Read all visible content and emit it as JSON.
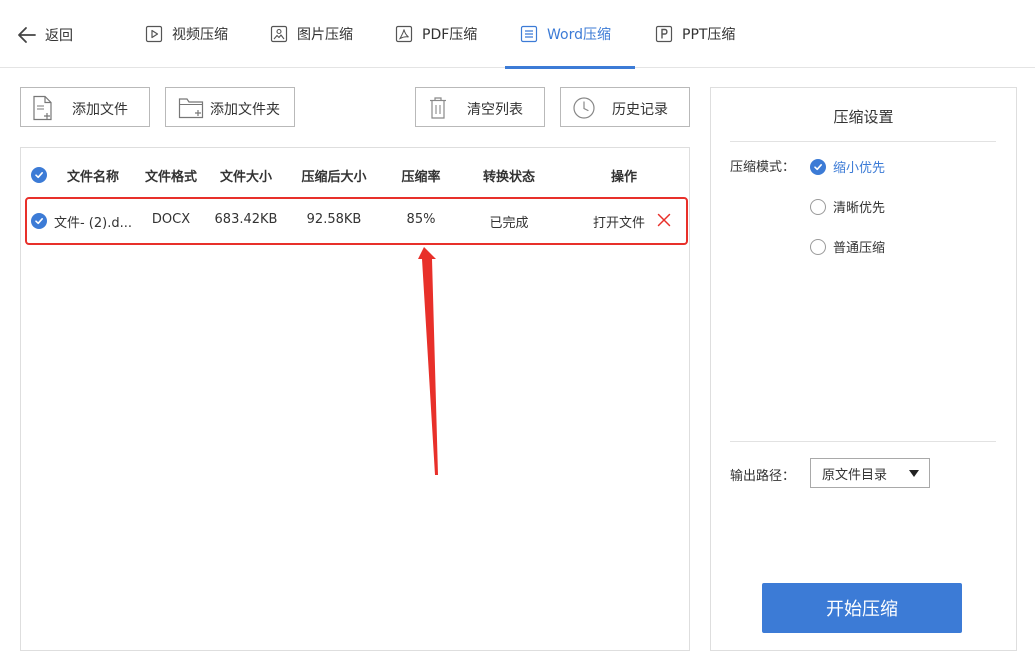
{
  "nav": {
    "back_label": "返回",
    "tabs": [
      {
        "label": "视频压缩",
        "icon": "video-icon",
        "active": false
      },
      {
        "label": "图片压缩",
        "icon": "image-icon",
        "active": false
      },
      {
        "label": "PDF压缩",
        "icon": "pdf-icon",
        "active": false
      },
      {
        "label": "Word压缩",
        "icon": "word-icon",
        "active": true
      },
      {
        "label": "PPT压缩",
        "icon": "ppt-icon",
        "active": false
      }
    ]
  },
  "toolbar": {
    "add_file": "添加文件",
    "add_folder": "添加文件夹",
    "clear_list": "清空列表",
    "history": "历史记录"
  },
  "table": {
    "headers": [
      "文件名称",
      "文件格式",
      "文件大小",
      "压缩后大小",
      "压缩率",
      "转换状态",
      "操作"
    ],
    "rows": [
      {
        "name": "文件- (2).d...",
        "format": "DOCX",
        "size": "683.42KB",
        "compressed_size": "92.58KB",
        "ratio": "85%",
        "status": "已完成",
        "action": "打开文件",
        "checked": true
      }
    ]
  },
  "settings": {
    "title": "压缩设置",
    "mode_label": "压缩模式：",
    "modes": [
      {
        "label": "缩小优先",
        "checked": true
      },
      {
        "label": "清晰优先",
        "checked": false
      },
      {
        "label": "普通压缩",
        "checked": false
      }
    ],
    "output_label": "输出路径：",
    "output_value": "原文件目录",
    "start_button": "开始压缩"
  },
  "colors": {
    "accent": "#3c7bd6",
    "highlight": "#e8302a"
  }
}
